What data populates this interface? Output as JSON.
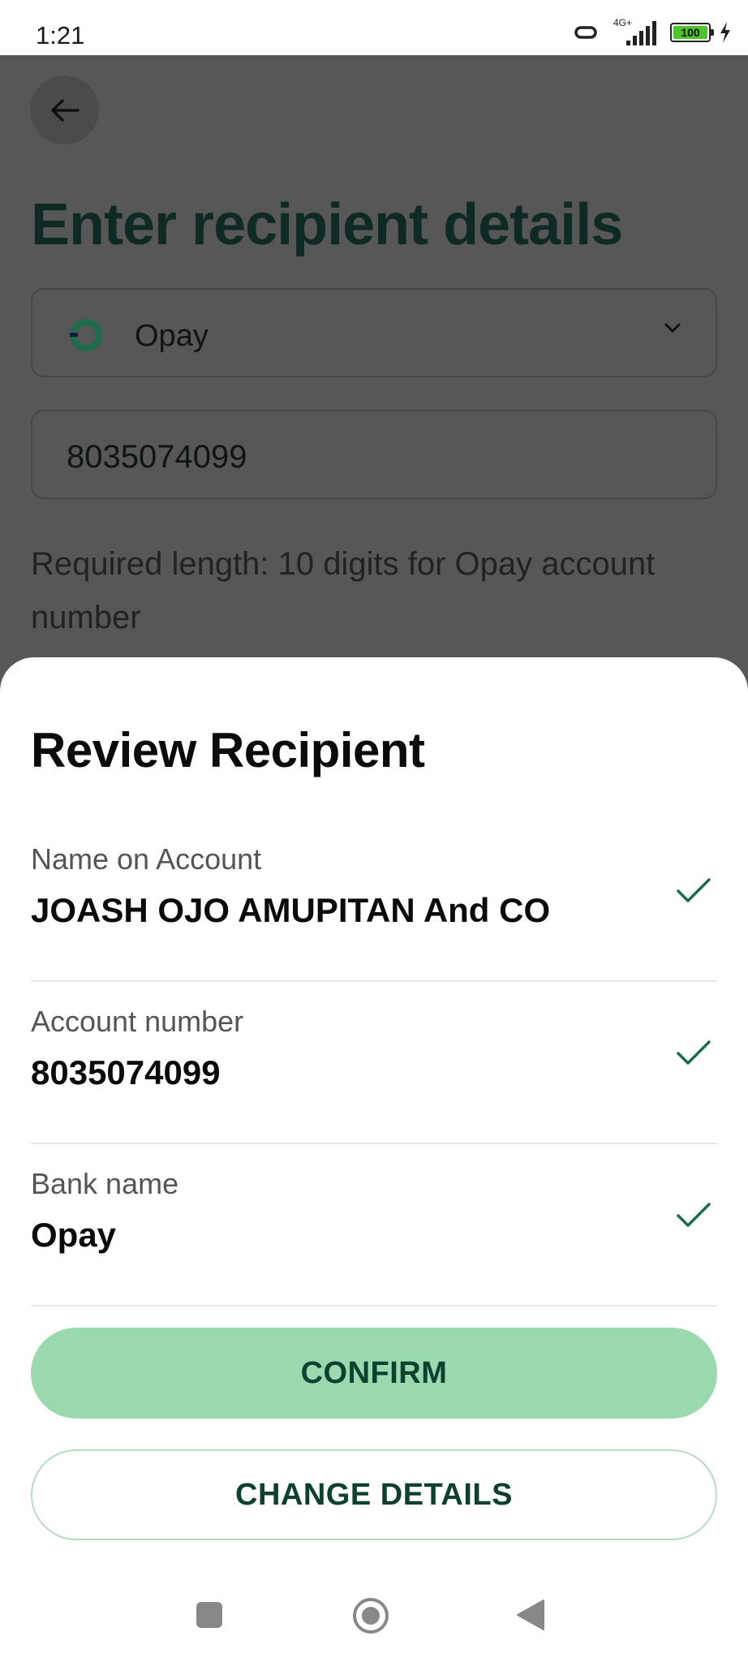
{
  "status_bar": {
    "time": "1:21",
    "network_label": "4G+",
    "battery_level": "100"
  },
  "background_page": {
    "title": "Enter recipient details",
    "bank_select": {
      "value": "Opay"
    },
    "account_input": {
      "value": "8035074099"
    },
    "helper_text": "Required length: 10 digits for Opay account number"
  },
  "sheet": {
    "title": "Review Recipient",
    "rows": [
      {
        "label": "Name on Account",
        "value": "JOASH OJO AMUPITAN And CO"
      },
      {
        "label": "Account number",
        "value": "8035074099"
      },
      {
        "label": "Bank name",
        "value": "Opay"
      }
    ],
    "confirm_label": "CONFIRM",
    "change_label": "CHANGE DETAILS"
  },
  "colors": {
    "accent": "#9ad8ae",
    "check": "#1e6b4d",
    "brand_dark": "#0e4030",
    "overlay": "#575757"
  },
  "icons": {
    "back": "arrow-left-icon",
    "chevron": "chevron-down-icon",
    "check": "check-icon",
    "bank_logo": "opay-logo-icon"
  }
}
